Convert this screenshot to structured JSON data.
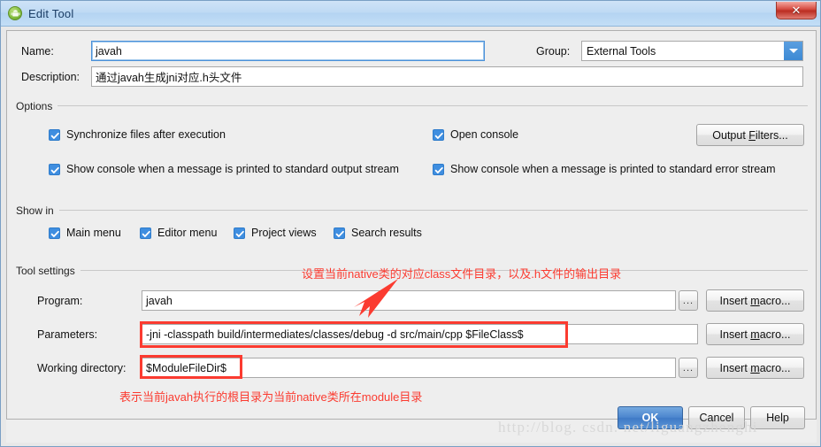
{
  "window": {
    "title": "Edit Tool",
    "icon": "android-robot-icon",
    "close_label": "✕"
  },
  "form": {
    "name": {
      "label": "Name:",
      "value": "javah",
      "placeholder": ""
    },
    "group": {
      "label": "Group:",
      "value": "External Tools",
      "options": [
        "External Tools"
      ]
    },
    "description": {
      "label": "Description:",
      "value": "通过javah生成jni对应.h头文件",
      "placeholder": ""
    }
  },
  "options": {
    "title": "Options",
    "checkboxes": [
      {
        "label": "Synchronize files after execution",
        "checked": true
      },
      {
        "label": "Open console",
        "checked": true
      },
      {
        "label": "Show console when a message is printed to standard output stream",
        "checked": true
      },
      {
        "label": "Show console when a message is printed to standard error stream",
        "checked": true
      }
    ],
    "output_filters_button": "Output Filters..."
  },
  "show_in": {
    "title": "Show in",
    "checkboxes": [
      {
        "label": "Main menu",
        "checked": true
      },
      {
        "label": "Editor menu",
        "checked": true
      },
      {
        "label": "Project views",
        "checked": true
      },
      {
        "label": "Search results",
        "checked": true
      }
    ]
  },
  "tool_settings": {
    "title": "Tool settings",
    "rows": [
      {
        "label": "Program:",
        "value": "javah",
        "browse_label": "...",
        "macro_label": "Insert macro..."
      },
      {
        "label": "Parameters:",
        "value": "-jni -classpath build/intermediates/classes/debug -d src/main/cpp $FileClass$",
        "browse_label": "",
        "macro_label": "Insert macro..."
      },
      {
        "label": "Working directory:",
        "value": "$ModuleFileDir$",
        "browse_label": "...",
        "macro_label": "Insert macro..."
      }
    ]
  },
  "annotations": {
    "top_note": "设置当前native类的对应class文件目录，以及.h文件的输出目录",
    "bottom_note": "表示当前javah执行的根目录为当前native类所在module目录",
    "color": "#fb3b30"
  },
  "footer": {
    "ok": "OK",
    "cancel": "Cancel",
    "help": "Help"
  },
  "watermark": {
    "text": "http://blog. csdn. net/liguangzhenghi"
  }
}
